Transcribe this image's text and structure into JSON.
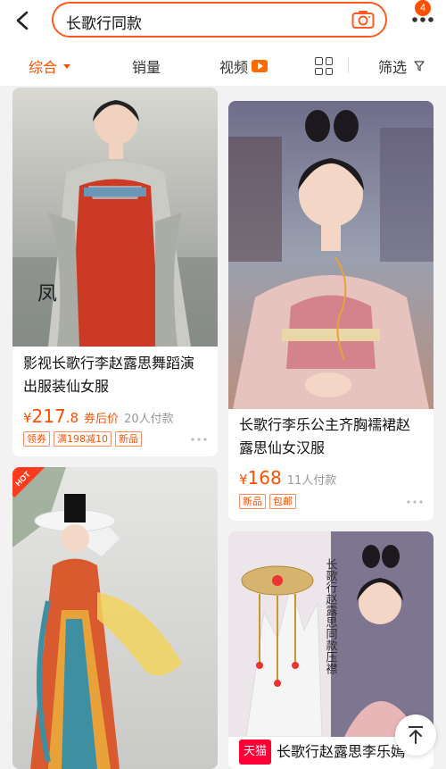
{
  "search": {
    "query": "长歌行同款"
  },
  "header": {
    "badge_count": "4"
  },
  "sortbar": {
    "items": [
      "综合",
      "销量",
      "视频",
      "筛选"
    ]
  },
  "products": [
    {
      "title_line1": "影视长歌行李赵露思舞蹈演",
      "title_line2": "出服装仙女服",
      "price_symbol": "¥",
      "price_int": "217",
      "price_dec": ".8",
      "coupon_text": "券后价",
      "sold": "20人付款",
      "tags": [
        "领券",
        "满198减10",
        "新品"
      ]
    },
    {
      "title_line1": "长歌行李乐公主齐胸襦裙赵",
      "title_line2": "露思仙女汉服",
      "price_symbol": "¥",
      "price_int": "168",
      "sold": "11人付款",
      "tags": [
        "新品",
        "包邮"
      ]
    },
    {
      "hot_label": "HOT"
    },
    {
      "store_badge": "天猫",
      "title_line1": "长歌行赵露思李乐嫣",
      "vertical_text": "长歌行赵露思同款压襟"
    }
  ],
  "colors": {
    "accent": "#ff5000",
    "tmall": "#ff0036"
  }
}
